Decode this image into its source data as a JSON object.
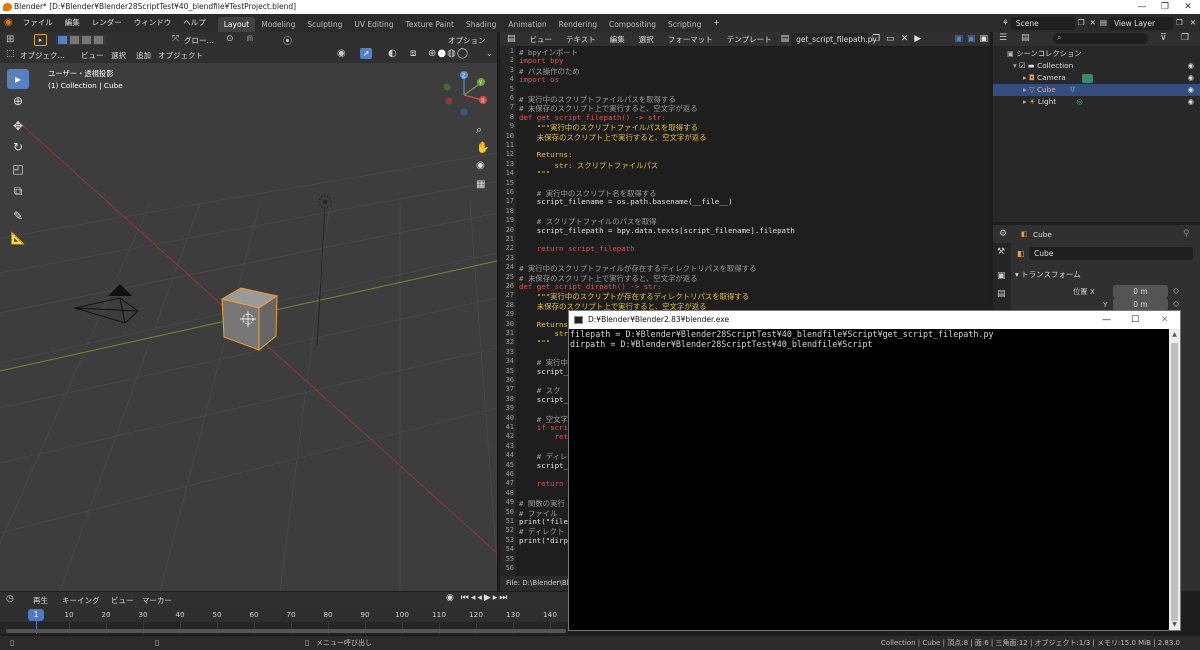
{
  "window": {
    "title": "Blender* [D:¥Blender¥Blender28ScriptTest¥40_blendfile¥TestProject.blend]",
    "minimize": "—",
    "maximize": "❐",
    "close": "✕"
  },
  "menu": [
    "ファイル",
    "編集",
    "レンダー",
    "ウィンドウ",
    "ヘルプ"
  ],
  "workspace_tabs": [
    {
      "label": "Layout",
      "active": true
    },
    {
      "label": "Modeling"
    },
    {
      "label": "Sculpting"
    },
    {
      "label": "UV Editing"
    },
    {
      "label": "Texture Paint"
    },
    {
      "label": "Shading"
    },
    {
      "label": "Animation"
    },
    {
      "label": "Rendering"
    },
    {
      "label": "Compositing"
    },
    {
      "label": "Scripting"
    }
  ],
  "add_workspace": "+",
  "scene": "Scene",
  "view_layer": "View Layer",
  "viewport": {
    "header": {
      "mode": "オブジェク…",
      "view": "ビュー",
      "select": "選択",
      "add": "追加",
      "object": "オブジェクト",
      "orientation": "グロー…",
      "options": "オプション"
    },
    "overlay_title": "ユーザー・透視投影",
    "overlay_subtitle": "(1) Collection | Cube",
    "gizmo": {
      "z": "Z",
      "y": "Y",
      "x": "X"
    }
  },
  "text_editor": {
    "menu": [
      "ビュー",
      "テキスト",
      "編集",
      "選択",
      "フォーマット",
      "テンプレート"
    ],
    "filename": "get_script_filepath.py",
    "footer": "File: D:\\Blender\\Blend"
  },
  "code_lines": [
    {
      "n": "1",
      "t": "# bpyインポート",
      "c": "cm"
    },
    {
      "n": "2",
      "t": "import bpy",
      "c": "kw"
    },
    {
      "n": "3",
      "t": "# パス操作のため",
      "c": "cm"
    },
    {
      "n": "4",
      "t": "import os",
      "c": "kw"
    },
    {
      "n": "5",
      "t": "",
      "c": "fn"
    },
    {
      "n": "6",
      "t": "# 実行中のスクリプトファイルパスを取得する",
      "c": "cm"
    },
    {
      "n": "7",
      "t": "# 未保存のスクリプト上で実行すると、空文字が返る",
      "c": "cm"
    },
    {
      "n": "8",
      "t": "def get_script_filepath() -> str:",
      "c": "kw"
    },
    {
      "n": "9",
      "t": "    \"\"\"実行中のスクリプトファイルパスを取得する",
      "c": "st"
    },
    {
      "n": "10",
      "t": "    未保存のスクリプト上で実行すると、空文字が返る",
      "c": "st"
    },
    {
      "n": "11",
      "t": "",
      "c": "fn"
    },
    {
      "n": "12",
      "t": "    Returns:",
      "c": "st"
    },
    {
      "n": "13",
      "t": "        str: スクリプトファイルパス",
      "c": "st"
    },
    {
      "n": "14",
      "t": "    \"\"\"",
      "c": "st"
    },
    {
      "n": "15",
      "t": "",
      "c": "fn"
    },
    {
      "n": "16",
      "t": "    # 実行中のスクリプト名を取得する",
      "c": "cm"
    },
    {
      "n": "17",
      "t": "    script_filename = os.path.basename(__file__)",
      "c": "fn"
    },
    {
      "n": "18",
      "t": "",
      "c": "fn"
    },
    {
      "n": "19",
      "t": "    # スクリプトファイルのパスを取得",
      "c": "cm"
    },
    {
      "n": "20",
      "t": "    script_filepath = bpy.data.texts[script_filename].filepath",
      "c": "fn"
    },
    {
      "n": "21",
      "t": "",
      "c": "fn"
    },
    {
      "n": "22",
      "t": "    return script_filepath",
      "c": "kw"
    },
    {
      "n": "23",
      "t": "",
      "c": "fn"
    },
    {
      "n": "24",
      "t": "# 実行中のスクリプトファイルが存在するディレクトリパスを取得する",
      "c": "cm"
    },
    {
      "n": "25",
      "t": "# 未保存のスクリプト上で実行すると、空文字が返る",
      "c": "cm"
    },
    {
      "n": "26",
      "t": "def get_script_dirpath() -> str:",
      "c": "kw"
    },
    {
      "n": "27",
      "t": "    \"\"\"実行中のスクリプトが存在するディレクトリパスを取得する",
      "c": "st"
    },
    {
      "n": "28",
      "t": "    未保存のスクリプト上で実行すると、空文字が返る",
      "c": "st"
    },
    {
      "n": "29",
      "t": "",
      "c": "fn"
    },
    {
      "n": "30",
      "t": "    Returns:",
      "c": "st"
    },
    {
      "n": "31",
      "t": "        str",
      "c": "st"
    },
    {
      "n": "32",
      "t": "    \"\"\"",
      "c": "st"
    },
    {
      "n": "33",
      "t": "",
      "c": "fn"
    },
    {
      "n": "34",
      "t": "    # 実行中",
      "c": "cm"
    },
    {
      "n": "35",
      "t": "    script_",
      "c": "fn"
    },
    {
      "n": "36",
      "t": "",
      "c": "fn"
    },
    {
      "n": "37",
      "t": "    # スク",
      "c": "cm"
    },
    {
      "n": "38",
      "t": "    script_",
      "c": "fn"
    },
    {
      "n": "39",
      "t": "",
      "c": "fn"
    },
    {
      "n": "40",
      "t": "    # 空文字",
      "c": "cm"
    },
    {
      "n": "41",
      "t": "    if scri",
      "c": "kw"
    },
    {
      "n": "42",
      "t": "        ret",
      "c": "kw"
    },
    {
      "n": "43",
      "t": "",
      "c": "fn"
    },
    {
      "n": "44",
      "t": "    # ディレ",
      "c": "cm"
    },
    {
      "n": "45",
      "t": "    script_",
      "c": "fn"
    },
    {
      "n": "46",
      "t": "",
      "c": "fn"
    },
    {
      "n": "47",
      "t": "    return",
      "c": "kw"
    },
    {
      "n": "48",
      "t": "",
      "c": "fn"
    },
    {
      "n": "49",
      "t": "# 関数の実行",
      "c": "cm"
    },
    {
      "n": "50",
      "t": "# ファイル",
      "c": "cm"
    },
    {
      "n": "51",
      "t": "print(\"file",
      "c": "fn"
    },
    {
      "n": "52",
      "t": "# ディレクト",
      "c": "cm"
    },
    {
      "n": "53",
      "t": "print(\"dirp",
      "c": "fn"
    },
    {
      "n": "54",
      "t": "",
      "c": "fn"
    },
    {
      "n": "55",
      "t": "",
      "c": "fn"
    },
    {
      "n": "56",
      "t": "",
      "c": "fn"
    }
  ],
  "outliner": {
    "search_placeholder": "",
    "scene_collection": "シーンコレクション",
    "items": [
      {
        "label": "Collection",
        "icon": "collection-icon"
      },
      {
        "label": "Camera",
        "icon": "camera-icon"
      },
      {
        "label": "Cube",
        "icon": "mesh-icon",
        "selected": true
      },
      {
        "label": "Light",
        "icon": "light-icon"
      }
    ]
  },
  "properties": {
    "context": "Cube",
    "object_name": "Cube",
    "panel_title": "トランスフォーム",
    "location_label": "位置 X",
    "y_label": "Y",
    "location_x": "0 m",
    "location_y": "0 m"
  },
  "timeline": {
    "menu": [
      "再生",
      "キーイング",
      "ビュー",
      "マーカー"
    ],
    "current_frame": "1",
    "ticks": [
      "10",
      "20",
      "30",
      "40",
      "50",
      "60",
      "70",
      "80",
      "90",
      "100",
      "110",
      "120",
      "130",
      "140"
    ]
  },
  "statusbar": {
    "menu_hint": "メニュー呼び出し",
    "info": "Collection | Cube | 頂点:8 | 面:6 | 三角面:12 | オブジェクト:1/3 | メモリ:15.0 MiB | 2.83.0"
  },
  "console": {
    "title": "D:¥Blender¥Blender2.83¥blender.exe",
    "lines": [
      "filepath = D:¥Blender¥Blender28ScriptTest¥40_blendfile¥Script¥get_script_filepath.py",
      "dirpath = D:¥Blender¥Blender28ScriptTest¥40_blendfile¥Script"
    ]
  }
}
